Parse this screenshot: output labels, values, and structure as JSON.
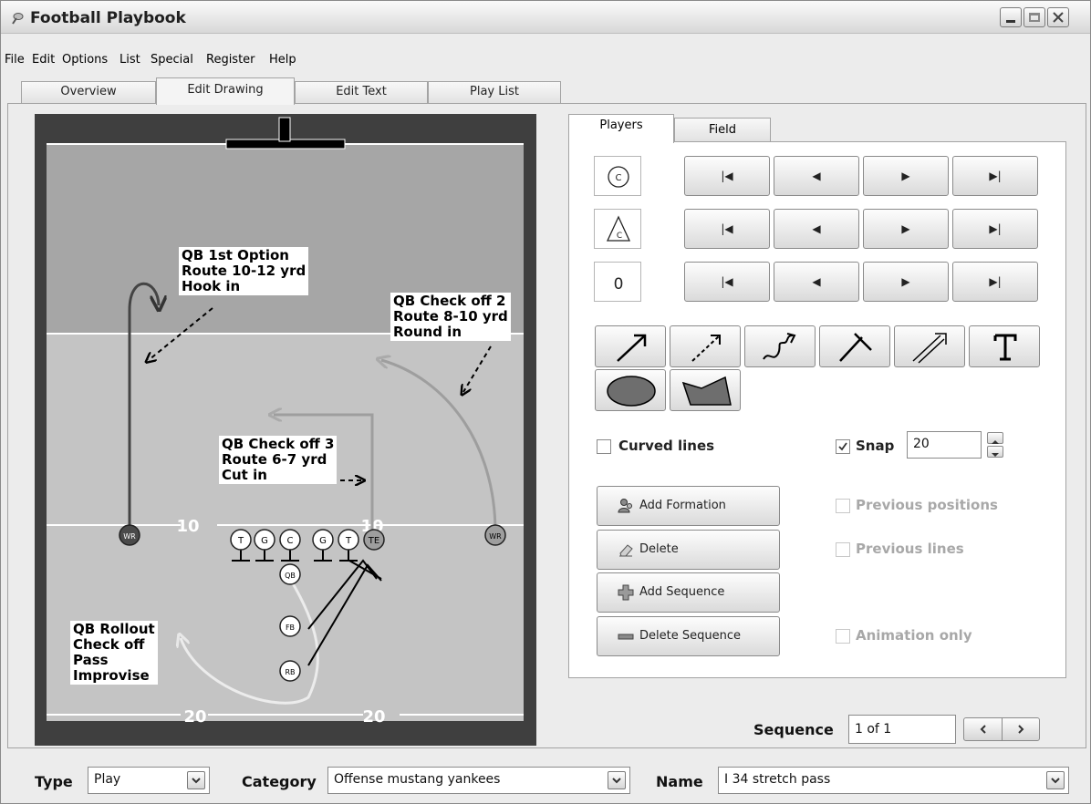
{
  "window": {
    "title": "Football Playbook"
  },
  "menu": [
    "File",
    "Edit",
    "Options",
    "List",
    "Special",
    "Register",
    "Help"
  ],
  "main_tabs": [
    "Overview",
    "Edit Drawing",
    "Edit Text",
    "Play List"
  ],
  "field": {
    "yard_labels_mid": [
      "10",
      "10"
    ],
    "yard_labels_bottom": [
      "20",
      "20"
    ],
    "notes": {
      "qb1": "QB 1st Option\nRoute 10-12 yrd\nHook in",
      "qb2": "QB Check off 2\nRoute 8-10 yrd\nRound in",
      "qb3": "QB Check off 3\nRoute 6-7 yrd\nCut in",
      "rollout": "QB Rollout\nCheck off\nPass\nImprovise"
    },
    "players": [
      "WR",
      "T",
      "G",
      "C",
      "G",
      "T",
      "TE",
      "WR",
      "QB",
      "FB",
      "RB"
    ]
  },
  "right_panel": {
    "tabs": [
      "Players",
      "Field"
    ],
    "player_symbols": [
      "C",
      "C",
      "0"
    ],
    "nav_glyphs": [
      "|◀",
      "◀",
      "▶",
      "▶|"
    ],
    "curved_lines_label": "Curved lines",
    "curved_lines_checked": false,
    "snap_label": "Snap",
    "snap_checked": true,
    "snap_value": "20",
    "buttons": {
      "add_formation": "Add Formation",
      "delete": "Delete",
      "add_sequence": "Add Sequence",
      "delete_sequence": "Delete Sequence"
    },
    "options": {
      "previous_positions": "Previous positions",
      "previous_lines": "Previous lines",
      "animation_only": "Animation only"
    }
  },
  "sequence": {
    "label": "Sequence",
    "value": "1 of 1"
  },
  "bottom": {
    "type_label": "Type",
    "type_value": "Play",
    "category_label": "Category",
    "category_value": "Offense mustang yankees",
    "name_label": "Name",
    "name_value": "I 34 stretch pass"
  }
}
